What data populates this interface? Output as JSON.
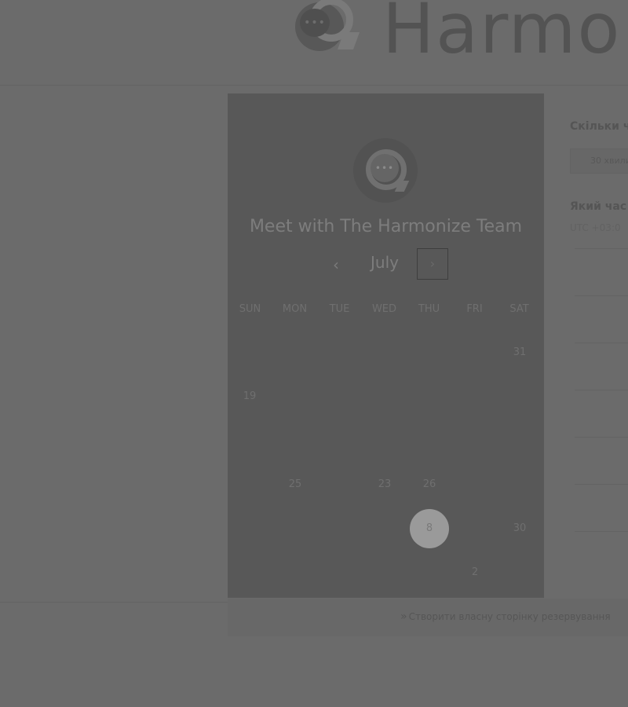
{
  "brand": {
    "wordmark": "Harmo",
    "bubble_glyph": "•••"
  },
  "card": {
    "logo_glyph": "•••",
    "title": "Meet with The Harmonize Team",
    "month": "July",
    "prev_glyph": "‹",
    "next_glyph": "›",
    "weekdays": [
      "SUN",
      "MON",
      "TUE",
      "WED",
      "THU",
      "FRI",
      "SAT"
    ],
    "days": [
      {
        "label": "31",
        "col": 6,
        "row": 0
      },
      {
        "label": "19",
        "col": 0,
        "row": 1
      },
      {
        "label": "25",
        "col": 1,
        "row": 3
      },
      {
        "label": "23",
        "col": 3,
        "row": 3
      },
      {
        "label": "26",
        "col": 4,
        "row": 3
      },
      {
        "label": "8",
        "col": 4,
        "row": 4,
        "selected": true
      },
      {
        "label": "30",
        "col": 6,
        "row": 4
      },
      {
        "label": "2",
        "col": 5,
        "row": 5
      }
    ]
  },
  "right_pane": {
    "duration_heading": "Скільки ч",
    "duration_value": "30 хвили",
    "time_heading": "Який час",
    "timezone": "UTC +03:0"
  },
  "footer": {
    "link_icon": "»",
    "link_text": "Створити власну сторінку резервування"
  }
}
